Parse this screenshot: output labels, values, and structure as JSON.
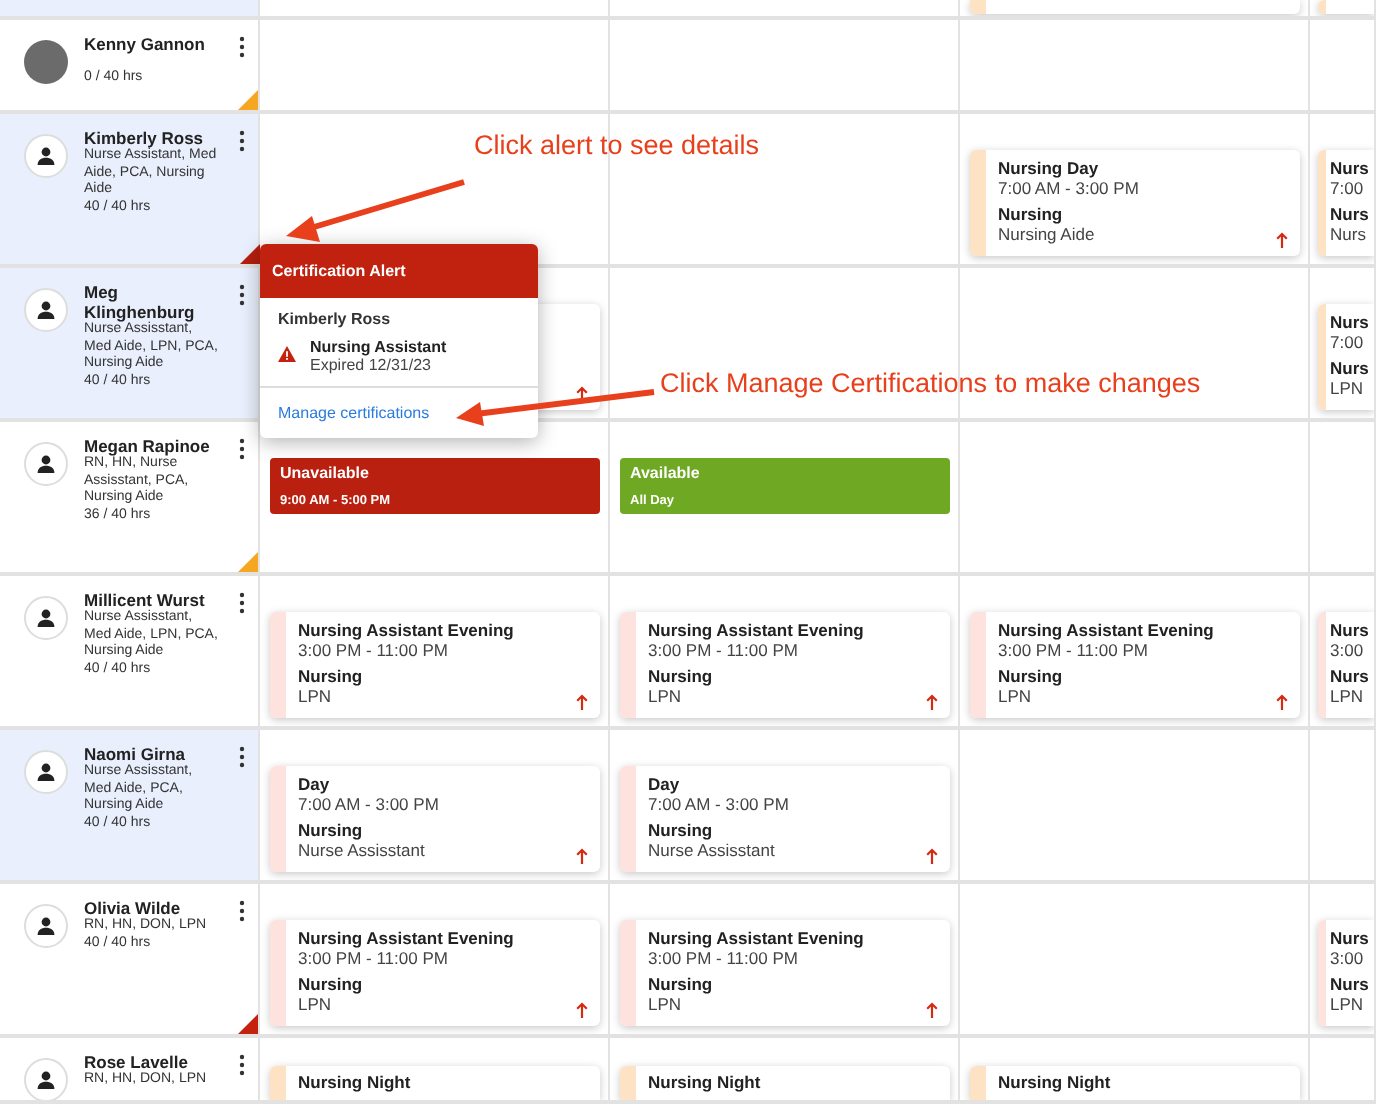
{
  "rows": [
    {
      "kind": "partial",
      "highlighted": true,
      "cells": [
        {
          "kind": "empty"
        },
        {
          "kind": "empty"
        },
        {
          "kind": "shift",
          "color": "#fde3c4"
        },
        {
          "kind": "shift",
          "color": "#fde3c4"
        }
      ]
    },
    {
      "kind": "employee",
      "name": "Kenny Gannon",
      "hours": "0 / 40 hrs",
      "photo": true,
      "highlighted": false,
      "color": "#f5a623",
      "cells": [
        {
          "kind": "empty"
        },
        {
          "kind": "empty"
        },
        {
          "kind": "empty"
        },
        {
          "kind": "empty"
        }
      ]
    },
    {
      "kind": "employee",
      "name": "Kimberly Ross",
      "roles": "Nurse Assistant, Med Aide, PCA, Nursing Aide",
      "hours": "40 / 40 hrs",
      "photo": false,
      "highlighted": true,
      "cells": [
        {
          "kind": "empty"
        },
        {
          "kind": "empty"
        },
        {
          "kind": "shift",
          "color": "#fde3c4",
          "title": "Nursing Day",
          "time": "7:00 AM - 3:00 PM",
          "department": "Nursing",
          "role": "Nursing Aide",
          "alert": true
        },
        {
          "kind": "shift",
          "color": "#fde3c4",
          "title": "Nurs",
          "time": "7:00",
          "department": "Nurs",
          "role": "Nurs",
          "alert": false
        }
      ]
    },
    {
      "kind": "employee",
      "name": "Meg Klinghenburg",
      "roles": "Nurse Assisstant, Med Aide, LPN, PCA, Nursing Aide",
      "hours": "40 / 40 hrs",
      "photo": false,
      "highlighted": true,
      "cells": [
        {
          "kind": "shift",
          "alert": true
        },
        {
          "kind": "empty"
        },
        {
          "kind": "empty"
        },
        {
          "kind": "shift",
          "color": "#fde3c4",
          "title": "Nurs",
          "time": "7:00",
          "department": "Nurs",
          "role": "LPN",
          "alert": false
        }
      ]
    },
    {
      "kind": "employee",
      "name": "Megan Rapinoe",
      "roles": "RN, HN, Nurse Assisstant, PCA, Nursing Aide",
      "hours": "36 / 40 hrs",
      "photo": false,
      "highlighted": false,
      "color": "#f5a623",
      "cells": [
        {
          "kind": "availability",
          "color": "#b9200f",
          "label": "Unavailable",
          "time": "9:00 AM - 5:00 PM"
        },
        {
          "kind": "availability",
          "color": "#6fa823",
          "label": "Available",
          "time": "All Day"
        },
        {
          "kind": "empty"
        },
        {
          "kind": "empty"
        }
      ]
    },
    {
      "kind": "employee",
      "name": "Millicent Wurst",
      "roles": "Nurse Assisstant, Med Aide, LPN, PCA, Nursing Aide",
      "hours": "40 / 40 hrs",
      "photo": false,
      "highlighted": false,
      "cells": [
        {
          "kind": "shift",
          "color": "#fde2de",
          "title": "Nursing Assistant Evening",
          "time": "3:00 PM - 11:00 PM",
          "department": "Nursing",
          "role": "LPN",
          "alert": true
        },
        {
          "kind": "shift",
          "color": "#fde2de",
          "title": "Nursing Assistant Evening",
          "time": "3:00 PM - 11:00 PM",
          "department": "Nursing",
          "role": "LPN",
          "alert": true
        },
        {
          "kind": "shift",
          "color": "#fde2de",
          "title": "Nursing Assistant Evening",
          "time": "3:00 PM - 11:00 PM",
          "department": "Nursing",
          "role": "LPN",
          "alert": true
        },
        {
          "kind": "shift",
          "color": "#fde2de",
          "title": "Nurs",
          "time": "3:00",
          "department": "Nurs",
          "role": "LPN",
          "alert": false
        }
      ]
    },
    {
      "kind": "employee",
      "name": "Naomi Girna",
      "roles": "Nurse Assisstant, Med Aide, PCA, Nursing Aide",
      "hours": "40 / 40 hrs",
      "photo": false,
      "highlighted": true,
      "cells": [
        {
          "kind": "shift",
          "color": "#fde2de",
          "title": "Day",
          "time": "7:00 AM - 3:00 PM",
          "department": "Nursing",
          "role": "Nurse Assisstant",
          "alert": true
        },
        {
          "kind": "shift",
          "color": "#fde2de",
          "title": "Day",
          "time": "7:00 AM - 3:00 PM",
          "department": "Nursing",
          "role": "Nurse Assisstant",
          "alert": true
        },
        {
          "kind": "empty"
        },
        {
          "kind": "empty"
        }
      ]
    },
    {
      "kind": "employee",
      "name": "Olivia Wilde",
      "roles": "RN, HN, DON, LPN",
      "hours": "40 / 40 hrs",
      "photo": false,
      "highlighted": false,
      "color": "#c4210f",
      "cells": [
        {
          "kind": "shift",
          "color": "#fde2de",
          "title": "Nursing Assistant Evening",
          "time": "3:00 PM - 11:00 PM",
          "department": "Nursing",
          "role": "LPN",
          "alert": true
        },
        {
          "kind": "shift",
          "color": "#fde2de",
          "title": "Nursing Assistant Evening",
          "time": "3:00 PM - 11:00 PM",
          "department": "Nursing",
          "role": "LPN",
          "alert": true
        },
        {
          "kind": "empty"
        },
        {
          "kind": "shift",
          "color": "#fde2de",
          "title": "Nurs",
          "time": "3:00",
          "department": "Nurs",
          "role": "LPN",
          "alert": false
        }
      ]
    },
    {
      "kind": "employee",
      "name": "Rose Lavelle",
      "roles": "RN, HN, DON, LPN",
      "photo": false,
      "highlighted": false,
      "cells": [
        {
          "kind": "shift",
          "color": "#fde3c4",
          "title": "Nursing Night"
        },
        {
          "kind": "shift",
          "color": "#fde3c4",
          "title": "Nursing Night"
        },
        {
          "kind": "shift",
          "color": "#fde3c4",
          "title": "Nursing Night"
        },
        {
          "kind": "empty"
        }
      ]
    }
  ],
  "certification_alert": {
    "title": "Certification Alert",
    "employee": "Kimberly Ross",
    "certification": "Nursing Assistant",
    "expiry": "Expired 12/31/23",
    "link": "Manage certifications"
  },
  "annotations": [
    {
      "text": "Click alert to see details"
    },
    {
      "text": "Click Manage Certifications to make changes"
    }
  ]
}
